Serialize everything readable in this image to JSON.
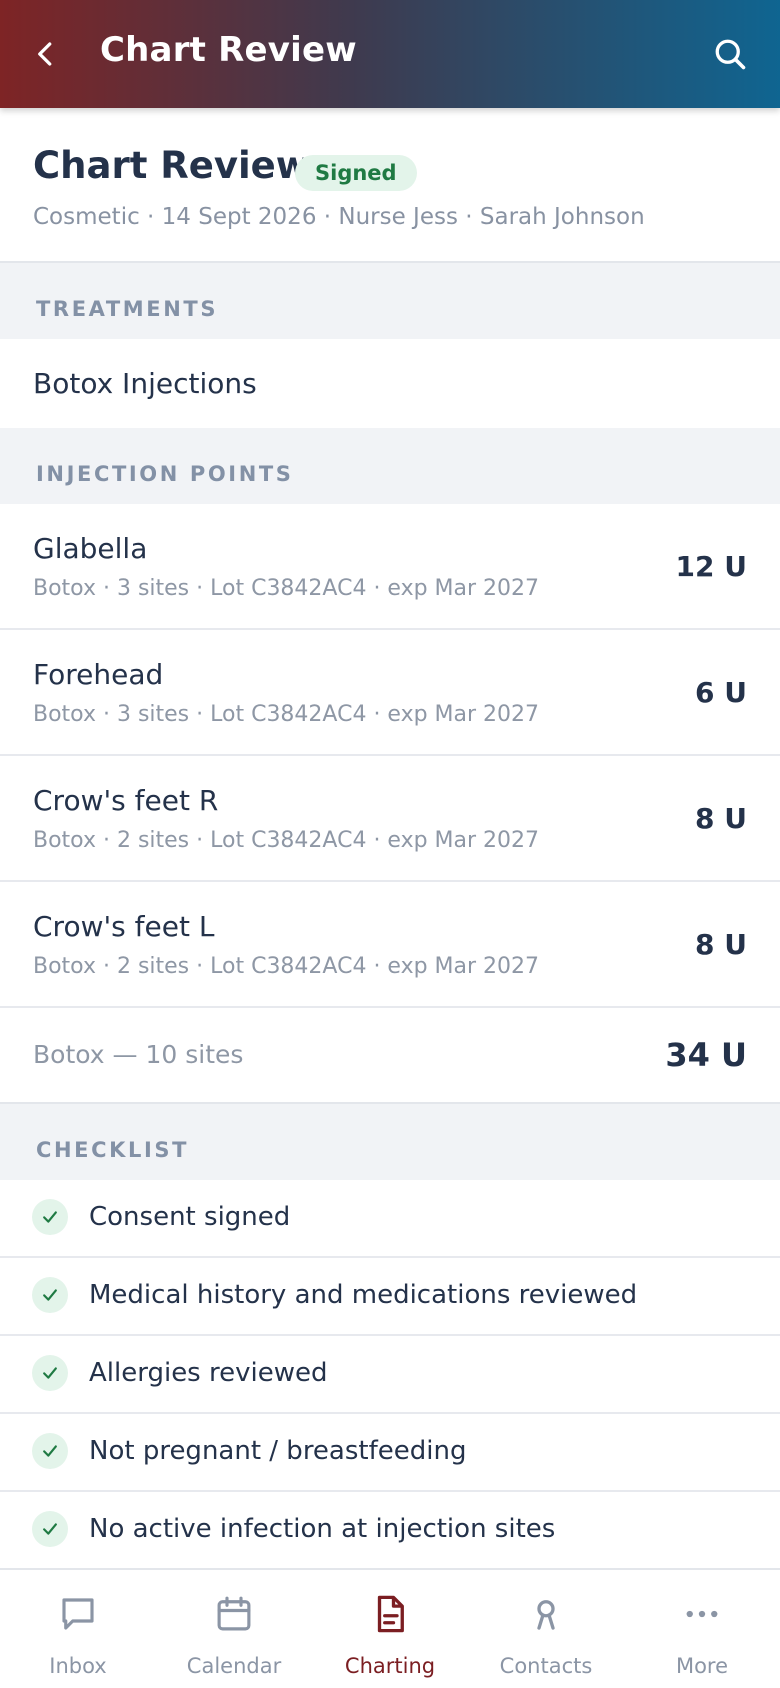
{
  "appbar": {
    "title": "Chart Review"
  },
  "summary": {
    "title": "Chart Review",
    "status": "Signed",
    "meta": "Cosmetic · 14 Sept 2026 · Nurse Jess · Sarah Johnson"
  },
  "sections": {
    "treatments": "TREATMENTS",
    "injection_points": "INJECTION POINTS",
    "checklist": "CHECKLIST"
  },
  "treatments": [
    {
      "name": "Botox Injections"
    }
  ],
  "injection_points": [
    {
      "site": "Glabella",
      "detail": "Botox · 3 sites · Lot C3842AC4 · exp Mar 2027",
      "units": "12 U"
    },
    {
      "site": "Forehead",
      "detail": "Botox · 3 sites · Lot C3842AC4 · exp Mar 2027",
      "units": "6 U"
    },
    {
      "site": "Crow's feet R",
      "detail": "Botox · 2 sites · Lot C3842AC4 · exp Mar 2027",
      "units": "8 U"
    },
    {
      "site": "Crow's feet L",
      "detail": "Botox · 2 sites · Lot C3842AC4 · exp Mar 2027",
      "units": "8 U"
    }
  ],
  "total": {
    "label": "Botox — 10 sites",
    "value": "34 U"
  },
  "checklist": [
    {
      "label": "Consent signed"
    },
    {
      "label": "Medical history and medications reviewed"
    },
    {
      "label": "Allergies reviewed"
    },
    {
      "label": "Not pregnant / breastfeeding"
    },
    {
      "label": "No active infection at injection sites"
    }
  ],
  "nav": [
    {
      "label": "Inbox",
      "icon": "chat-bubble-icon"
    },
    {
      "label": "Calendar",
      "icon": "calendar-icon"
    },
    {
      "label": "Charting",
      "icon": "document-icon",
      "active": true
    },
    {
      "label": "Contacts",
      "icon": "person-icon"
    },
    {
      "label": "More",
      "icon": "more-dots-icon"
    }
  ],
  "colors": {
    "accent": "#7b1e22",
    "status_green": "#1f7a43",
    "header_start": "#7e2425",
    "header_end": "#0f6591"
  }
}
